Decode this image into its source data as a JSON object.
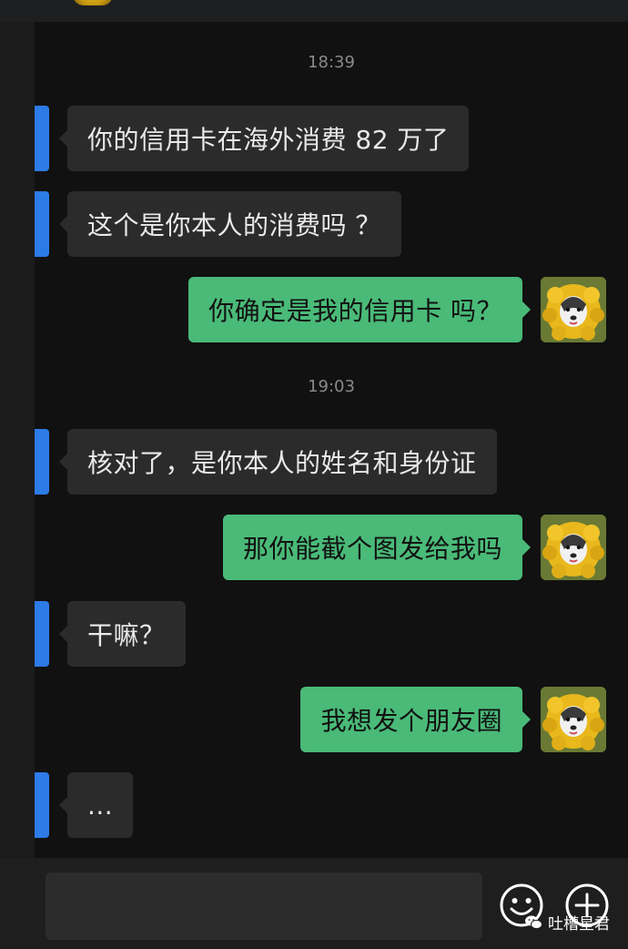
{
  "timestamps": [
    "18:39",
    "19:03"
  ],
  "messages": [
    {
      "side": "in",
      "text": "你的信用卡在海外消费 82 万了"
    },
    {
      "side": "in",
      "text": "这个是你本人的消费吗 ？"
    },
    {
      "side": "out",
      "text": "你确定是我的信用卡 吗？"
    },
    {
      "side": "in",
      "text": "核对了，是你本人的姓名和身份证"
    },
    {
      "side": "out",
      "text": "那你能截个图发给我吗"
    },
    {
      "side": "in",
      "text": "干嘛？"
    },
    {
      "side": "out",
      "text": "我想发个朋友圈"
    },
    {
      "side": "in",
      "text": "..."
    }
  ],
  "composer": {
    "input_value": "",
    "emoji_icon": "smiley-face-icon",
    "plus_icon": "plus-circle-icon"
  },
  "watermark": {
    "text": "吐槽星君",
    "icon": "wechat-icon"
  },
  "colors": {
    "incoming_bubble": "#2b2b2b",
    "outgoing_bubble": "#4aba78",
    "peer_avatar": "#2d7be6",
    "chat_background": "#111111"
  }
}
